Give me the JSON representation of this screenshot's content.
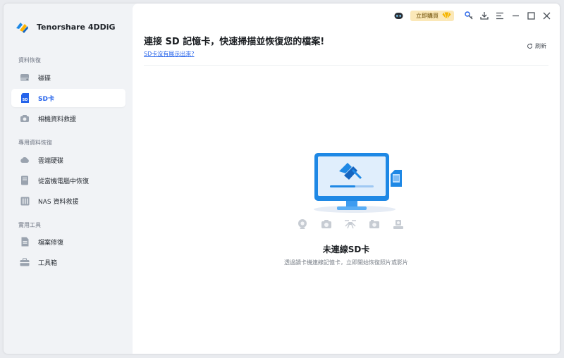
{
  "app": {
    "name": "Tenorshare 4DDiG"
  },
  "sidebar": {
    "sections": [
      {
        "title": "資料恢復",
        "items": [
          {
            "label": "磁碟",
            "icon": "disk-icon"
          },
          {
            "label": "SD卡",
            "icon": "sd-card-icon",
            "active": true
          },
          {
            "label": "相機資料救援",
            "icon": "camera-icon"
          }
        ]
      },
      {
        "title": "專用資料恢復",
        "items": [
          {
            "label": "雲端硬碟",
            "icon": "cloud-icon"
          },
          {
            "label": "從當機電腦中恢復",
            "icon": "crashed-computer-icon"
          },
          {
            "label": "NAS 資料救援",
            "icon": "nas-icon"
          }
        ]
      },
      {
        "title": "實用工具",
        "items": [
          {
            "label": "檔案修復",
            "icon": "file-repair-icon"
          },
          {
            "label": "工具箱",
            "icon": "toolbox-icon"
          }
        ]
      }
    ]
  },
  "titlebar": {
    "buy_label": "立即購買"
  },
  "main": {
    "title": "連接 SD 記憶卡，快速掃描並恢復您的檔案!",
    "help_link": "SD卡沒有展示出來?",
    "refresh_label": "刷新",
    "empty_title": "未連線SD卡",
    "empty_subtitle": "透過讀卡機連線記憶卡，立即開始恢復照片或影片"
  },
  "colors": {
    "accent": "#2563eb",
    "buy_bg": "#fbe8b8",
    "sidebar_bg": "#f1f3f6"
  }
}
